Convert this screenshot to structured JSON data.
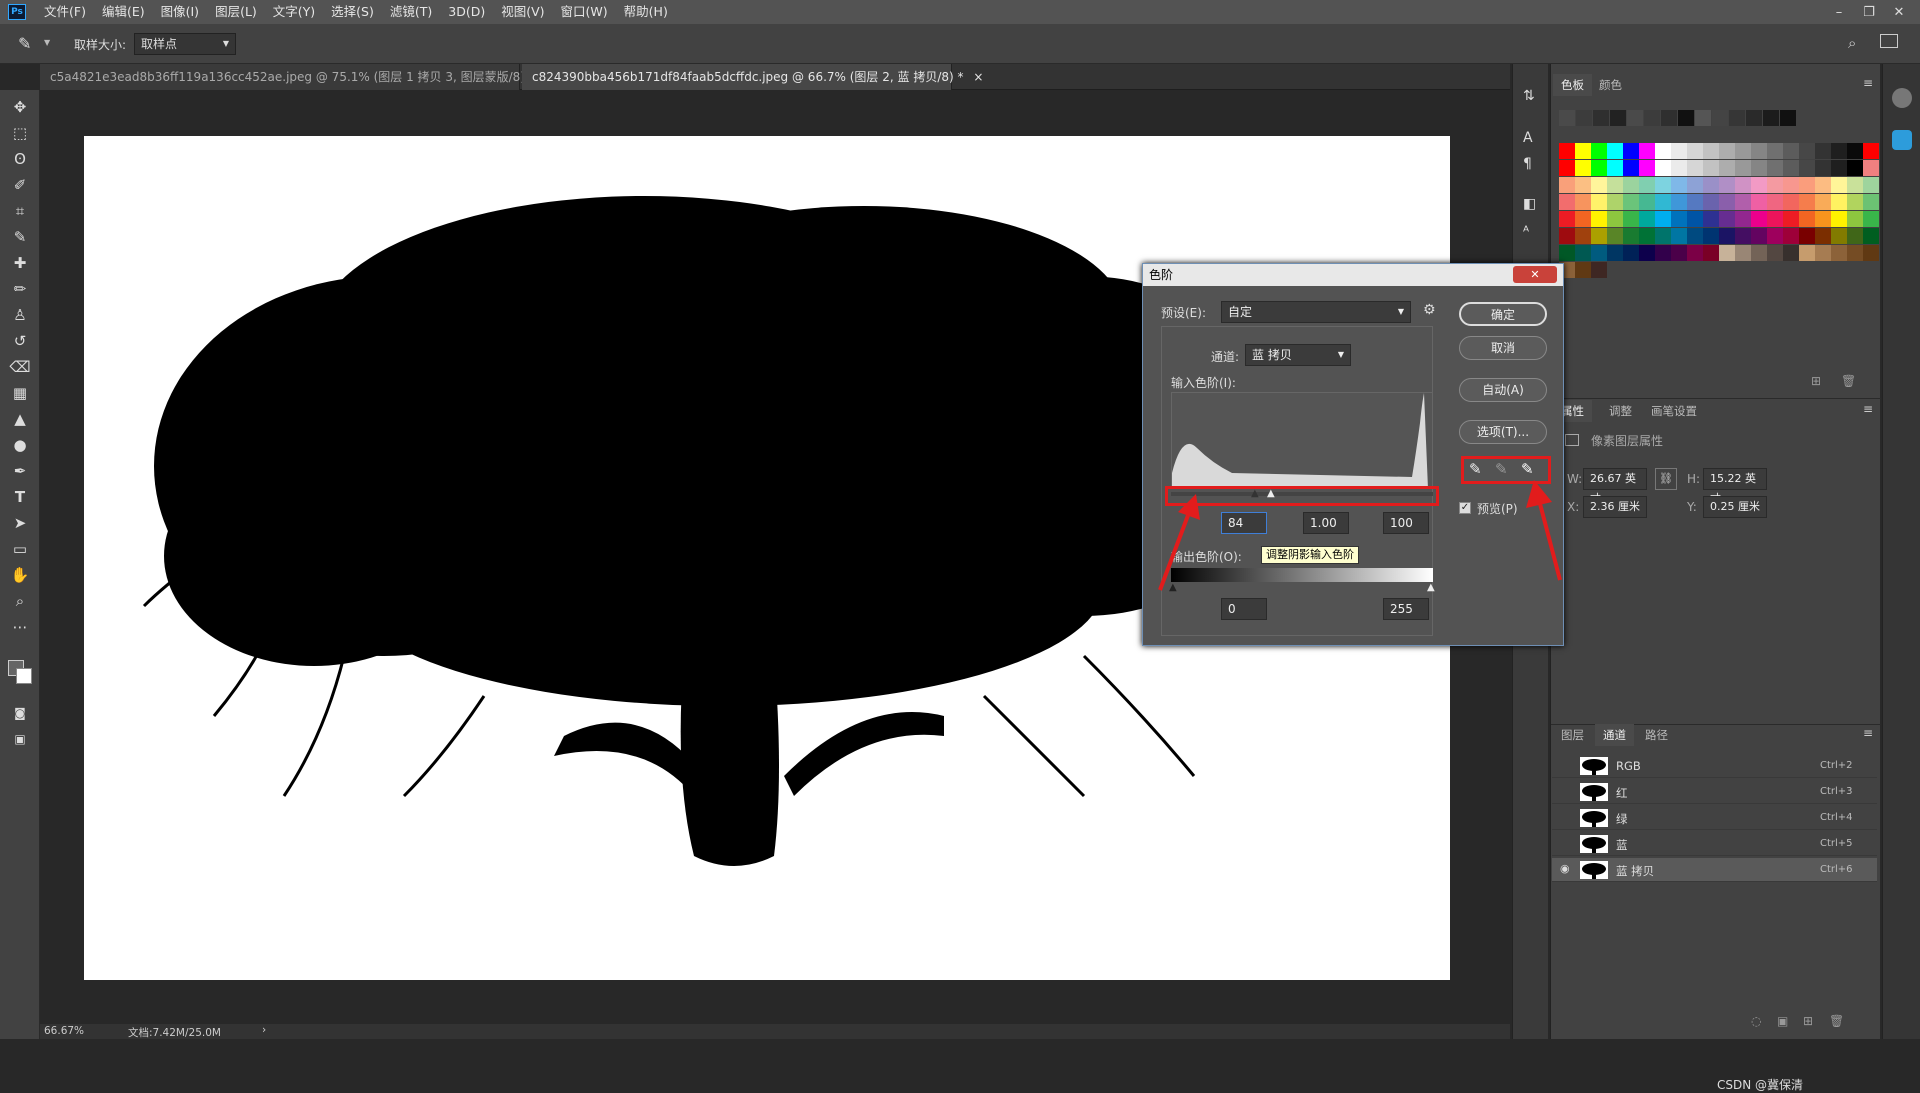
{
  "menubar": {
    "logo": "Ps",
    "items": [
      "文件(F)",
      "编辑(E)",
      "图像(I)",
      "图层(L)",
      "文字(Y)",
      "选择(S)",
      "滤镜(T)",
      "3D(D)",
      "视图(V)",
      "窗口(W)",
      "帮助(H)"
    ]
  },
  "options": {
    "sample_label": "取样大小:",
    "sample_value": "取样点"
  },
  "tabs": [
    {
      "label": "c5a4821e3ead8b36ff119a136cc452ae.jpeg @ 75.1% (图层 1 拷贝 3, 图层蒙版/8) *"
    },
    {
      "label": "c824390bba456b171df84faab5dcffdc.jpeg @ 66.7% (图层 2, 蓝 拷贝/8) *"
    }
  ],
  "status": {
    "zoom": "66.67%",
    "doc": "文档:7.42M/25.0M"
  },
  "panels": {
    "swatch_tabs": [
      "色板",
      "颜色"
    ],
    "props_tabs": [
      "属性",
      "调整",
      "画笔设置"
    ],
    "props_subtitle": "像素图层属性",
    "w_label": "W:",
    "w_value": "26.67 英寸",
    "h_label": "H:",
    "h_value": "15.22 英寸",
    "x_label": "X:",
    "x_value": "2.36 厘米",
    "y_label": "Y:",
    "y_value": "0.25 厘米",
    "layer_tabs": [
      "图层",
      "通道",
      "路径"
    ],
    "channels": [
      {
        "name": "RGB",
        "shortcut": "Ctrl+2"
      },
      {
        "name": "红",
        "shortcut": "Ctrl+3"
      },
      {
        "name": "绿",
        "shortcut": "Ctrl+4"
      },
      {
        "name": "蓝",
        "shortcut": "Ctrl+5"
      },
      {
        "name": "蓝 拷贝",
        "shortcut": "Ctrl+6"
      }
    ]
  },
  "dialog": {
    "title": "色阶",
    "preset_label": "预设(E):",
    "preset_value": "自定",
    "channel_label": "通道:",
    "channel_value": "蓝 拷贝",
    "input_label": "输入色阶(I):",
    "input_black": "84",
    "input_gamma": "1.00",
    "input_white": "100",
    "output_label": "输出色阶(O):",
    "tooltip": "调整阴影输入色阶",
    "output_black": "0",
    "output_white": "255",
    "ok": "确定",
    "cancel": "取消",
    "auto": "自动(A)",
    "options": "选项(T)...",
    "preview": "预览(P)",
    "preview_checked": true
  },
  "watermark": "CSDN @冀保清",
  "swatch_colors": {
    "grays": [
      "#4a4a4a",
      "#3c3c3c",
      "#2f2f2f",
      "#222",
      "#4a4a4a",
      "#3c3c3c",
      "#2f2f2f",
      "#111",
      "#555",
      "#444",
      "#363636",
      "#2a2a2a",
      "#1c1c1c",
      "#111"
    ],
    "row1": [
      "#ff0000",
      "#ffff00",
      "#00ff00",
      "#00ffff",
      "#0000ff",
      "#ff00ff",
      "#ffffff",
      "#ebebeb",
      "#d6d6d6",
      "#c2c2c2",
      "#adadad",
      "#999",
      "#858585",
      "#707070",
      "#5c5c5c",
      "#474747",
      "#333",
      "#1f1f1f",
      "#0a0a0a",
      "#ff0000"
    ],
    "row2": [
      "#ff0000",
      "#ffff00",
      "#00ff00",
      "#00ffff",
      "#0000ff",
      "#ff00ff",
      "#ffffff",
      "#ebebeb",
      "#d6d6d6",
      "#c2c2c2",
      "#adadad",
      "#999",
      "#858585",
      "#707070",
      "#5c5c5c",
      "#474747",
      "#333",
      "#1f1f1f",
      "#000",
      "#f08080"
    ],
    "row3": [
      "#f9a07a",
      "#fbbf83",
      "#fff59b",
      "#c5e09b",
      "#9bd39e",
      "#80cfb0",
      "#7dd3e0",
      "#7fb8e8",
      "#8da2d6",
      "#9a90c8",
      "#b08fc6",
      "#d092c5",
      "#f29ac5",
      "#f49aa1",
      "#f7978f",
      "#fa9d7c",
      "#fcbc82",
      "#fff598",
      "#c9e19a",
      "#9ed49d"
    ],
    "row4": [
      "#f26d6d",
      "#f7945e",
      "#fff26a",
      "#aed36a",
      "#6bc47a",
      "#46b892",
      "#30b8d3",
      "#3f97d9",
      "#5579c1",
      "#6a63ad",
      "#8a5fab",
      "#b15fab",
      "#ef60a4",
      "#f06681",
      "#f2665e",
      "#f57d4c",
      "#f9ab58",
      "#fff261",
      "#b1d45e",
      "#6cc273"
    ],
    "row5": [
      "#ed1c24",
      "#f26522",
      "#fff200",
      "#8dc63f",
      "#39b54a",
      "#00a99d",
      "#00aeef",
      "#0072bc",
      "#0054a6",
      "#2e3192",
      "#662d91",
      "#92278f",
      "#ec008c",
      "#ed145b",
      "#ed1c24",
      "#f26522",
      "#f7941d",
      "#fff200",
      "#8dc63f",
      "#39b54a"
    ],
    "row6": [
      "#9e0b0f",
      "#a0410d",
      "#aba000",
      "#598527",
      "#197b30",
      "#007236",
      "#00746b",
      "#0076a3",
      "#004a80",
      "#003471",
      "#1b1464",
      "#440e62",
      "#630460",
      "#9e005d",
      "#9e0039",
      "#790000",
      "#7b2e00",
      "#827b00",
      "#406618",
      "#005e20"
    ],
    "row7": [
      "#005826",
      "#005952",
      "#005b7f",
      "#003663",
      "#002157",
      "#0d004c",
      "#32004b",
      "#4b0049",
      "#7b0046",
      "#7a0026",
      "#c7b299",
      "#998675",
      "#736357",
      "#534741",
      "#37302d",
      "#c69c6d",
      "#a67c52",
      "#8c6239",
      "#754c24",
      "#603913"
    ],
    "row8": [
      "#8c6239",
      "#603913",
      "#3e2723"
    ]
  }
}
